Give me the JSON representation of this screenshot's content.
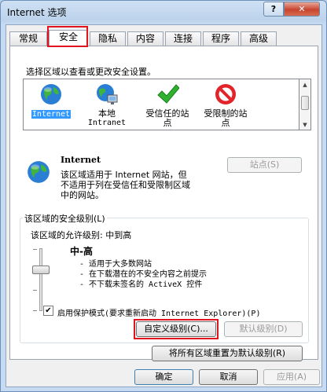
{
  "window": {
    "title": "Internet 选项",
    "help_label": "?",
    "close_label": "✕"
  },
  "tabs": [
    {
      "label": "常规"
    },
    {
      "label": "安全"
    },
    {
      "label": "隐私"
    },
    {
      "label": "内容"
    },
    {
      "label": "连接"
    },
    {
      "label": "程序"
    },
    {
      "label": "高级"
    }
  ],
  "active_tab": "安全",
  "security": {
    "instruction": "选择区域以查看或更改安全设置。",
    "zones": [
      {
        "name_line1": "Internet",
        "name_line2": "",
        "icon": "globe-icon"
      },
      {
        "name_line1": "本地",
        "name_line2": "Intranet",
        "icon": "intranet-icon"
      },
      {
        "name_line1": "受信任的站",
        "name_line2": "点",
        "icon": "checkmark-icon"
      },
      {
        "name_line1": "受限制的站",
        "name_line2": "点",
        "icon": "restricted-icon"
      }
    ],
    "selected_zone": {
      "title": "Internet",
      "desc_line1": "该区域适用于 Internet 网站，但",
      "desc_line2": "不适用于列在受信任和受限制区域",
      "desc_line3": "中的网站。",
      "sites_button": "站点(S)"
    },
    "level_group": {
      "title": "该区域的安全级别(L)",
      "allowed": "该区域的允许级别: 中到高",
      "level_name": "中-高",
      "bullets": [
        "- 适用于大多数网站",
        "- 在下载潜在的不安全内容之前提示",
        "- 不下载未签名的 ActiveX 控件"
      ],
      "protected_mode": "启用保护模式(要求重新启动 Internet Explorer)(P)",
      "protected_checked": true,
      "custom_button": "自定义级别(C)...",
      "default_button": "默认级别(D)"
    },
    "reset_button": "将所有区域重置为默认级别(R)"
  },
  "dialog_buttons": {
    "ok": "确定",
    "cancel": "取消",
    "apply": "应用(A)"
  },
  "colors": {
    "highlight": "#3399ff",
    "annotation_red": "#e0141e",
    "titlebar": "#bcd3ec"
  }
}
